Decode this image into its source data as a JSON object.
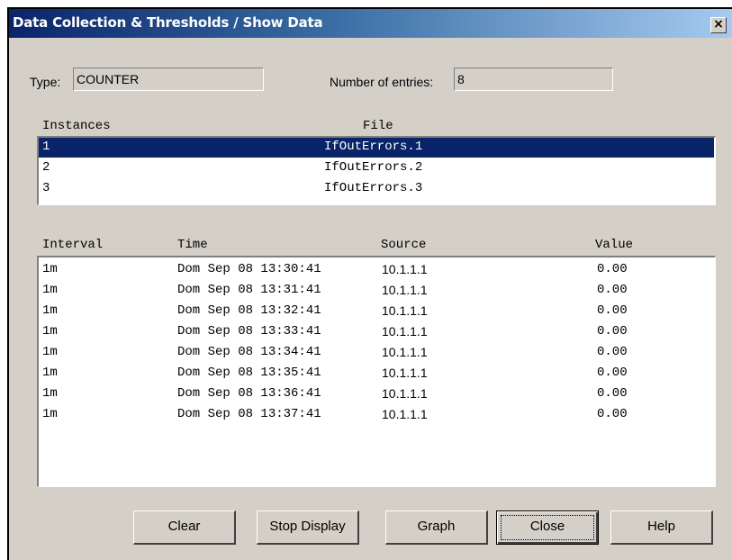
{
  "window": {
    "title": "Data Collection & Thresholds / Show Data",
    "close_glyph": "×"
  },
  "info": {
    "type_label": "Type:",
    "type_value": "COUNTER",
    "entries_label": "Number of entries:",
    "entries_value": "8"
  },
  "instances": {
    "headers": {
      "instance": "Instances",
      "file": "File"
    },
    "rows": [
      {
        "instance": "1",
        "file": "IfOutErrors.1",
        "selected": true
      },
      {
        "instance": "2",
        "file": "IfOutErrors.2",
        "selected": false
      },
      {
        "instance": "3",
        "file": "IfOutErrors.3",
        "selected": false
      }
    ]
  },
  "data": {
    "headers": {
      "interval": "Interval",
      "time": "Time",
      "source": "Source",
      "value": "Value"
    },
    "rows": [
      {
        "interval": "1m",
        "time": "Dom Sep 08 13:30:41",
        "source": "10.1.1.1",
        "value": "0.00"
      },
      {
        "interval": "1m",
        "time": "Dom Sep 08 13:31:41",
        "source": "10.1.1.1",
        "value": "0.00"
      },
      {
        "interval": "1m",
        "time": "Dom Sep 08 13:32:41",
        "source": "10.1.1.1",
        "value": "0.00"
      },
      {
        "interval": "1m",
        "time": "Dom Sep 08 13:33:41",
        "source": "10.1.1.1",
        "value": "0.00"
      },
      {
        "interval": "1m",
        "time": "Dom Sep 08 13:34:41",
        "source": "10.1.1.1",
        "value": "0.00"
      },
      {
        "interval": "1m",
        "time": "Dom Sep 08 13:35:41",
        "source": "10.1.1.1",
        "value": "0.00"
      },
      {
        "interval": "1m",
        "time": "Dom Sep 08 13:36:41",
        "source": "10.1.1.1",
        "value": "0.00"
      },
      {
        "interval": "1m",
        "time": "Dom Sep 08 13:37:41",
        "source": "10.1.1.1",
        "value": "0.00"
      }
    ]
  },
  "buttons": {
    "clear": "Clear",
    "stop_display": "Stop Display",
    "graph": "Graph",
    "close": "Close",
    "help": "Help"
  }
}
